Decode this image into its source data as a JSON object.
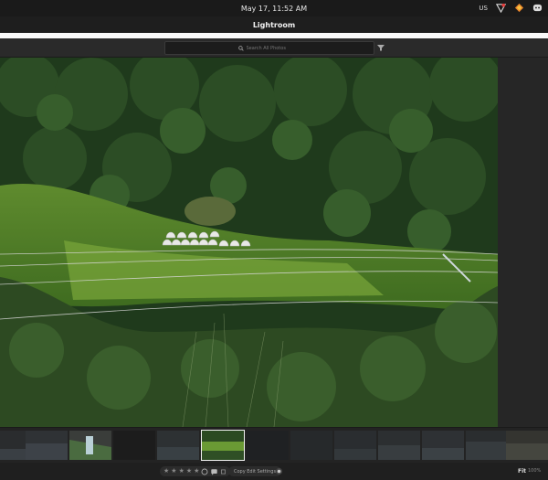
{
  "system_bar": {
    "clock": "May 17, 11:52 AM",
    "language": "US",
    "tray_icons": [
      "network-icon",
      "brave-icon",
      "discord-icon"
    ]
  },
  "app": {
    "title": "Lightroom"
  },
  "toolbar": {
    "search_placeholder": "Search All Photos",
    "filter_icon": "filter-icon"
  },
  "filmstrip": {
    "thumbnails": [
      {
        "label": "photo-1"
      },
      {
        "label": "photo-2"
      },
      {
        "label": "photo-3"
      },
      {
        "label": "photo-4"
      },
      {
        "label": "photo-5"
      },
      {
        "label": "photo-6",
        "selected": true
      },
      {
        "label": "photo-7"
      },
      {
        "label": "photo-8"
      },
      {
        "label": "photo-9"
      },
      {
        "label": "photo-10"
      },
      {
        "label": "photo-11"
      },
      {
        "label": "photo-12"
      },
      {
        "label": "photo-13"
      }
    ]
  },
  "bottom_bar": {
    "rating_stars": 5,
    "rating_value": 0,
    "copy_label": "Copy Edit Settings",
    "fit_label": "Fit",
    "zoom_label": "100%"
  },
  "colors": {
    "background": "#111111",
    "panel": "#2b2b2b",
    "accent": "#f2f2f2"
  }
}
